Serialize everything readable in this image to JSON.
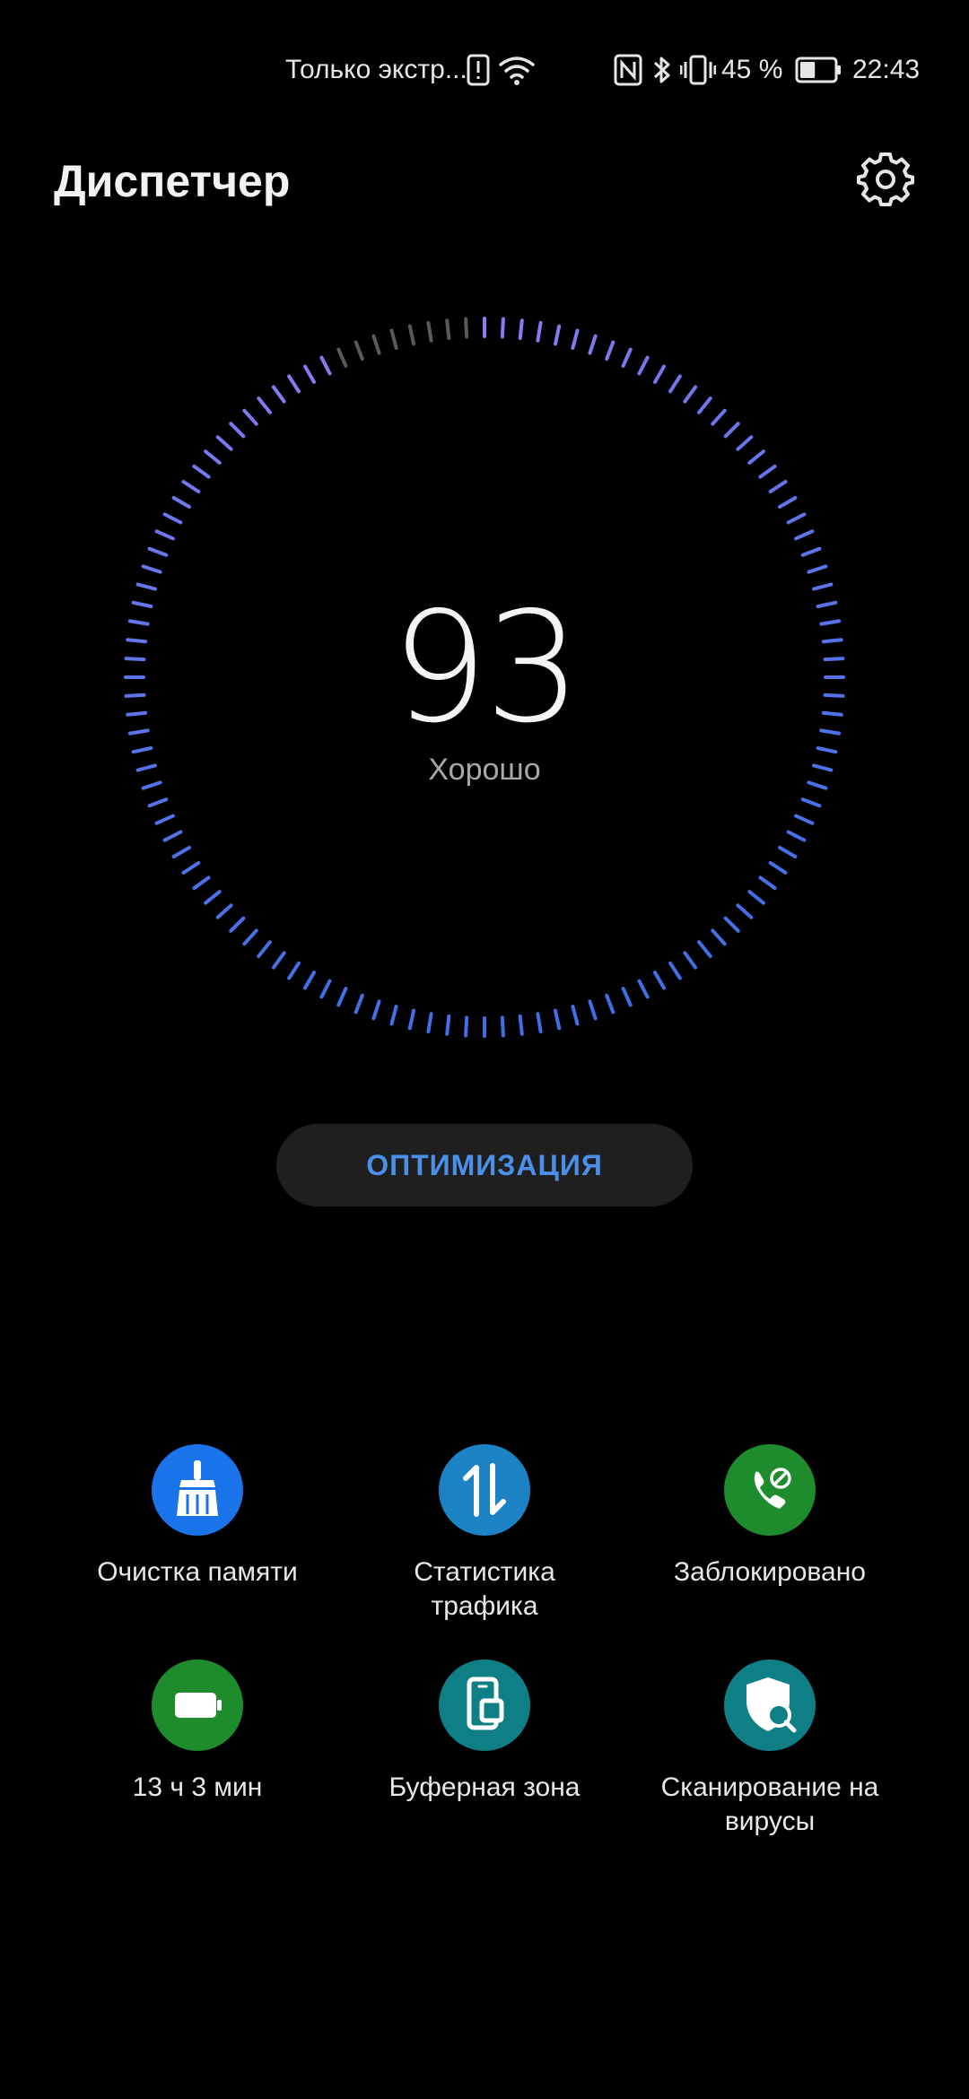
{
  "status_bar": {
    "notification_text": "Только экстр...",
    "battery_percent": "45 %",
    "battery_level": 0.45,
    "time": "22:43",
    "icons": [
      "alert-icon",
      "wifi-icon",
      "nfc-icon",
      "bluetooth-icon",
      "vibrate-icon",
      "battery-icon"
    ]
  },
  "header": {
    "title": "Диспетчер",
    "settings_icon": "gear-icon"
  },
  "gauge": {
    "score": "93",
    "status": "Хорошо",
    "fill_fraction": 0.93,
    "colors": {
      "start": "#8a7cf2",
      "end": "#3f6fe6",
      "inactive": "#5a5a5a"
    }
  },
  "optimize_button": {
    "label": "ОПТИМИЗАЦИЯ",
    "color": "#4a8fe8"
  },
  "tiles": [
    {
      "label": "Очистка памяти",
      "icon": "broom-icon",
      "color": "#1a73e8"
    },
    {
      "label": "Статистика трафика",
      "icon": "data-transfer-icon",
      "color": "#1b82c4"
    },
    {
      "label": "Заблокировано",
      "icon": "blocked-call-icon",
      "color": "#1e8c2d"
    },
    {
      "label": "13 ч 3 мин",
      "icon": "battery-icon",
      "color": "#1e8c2d"
    },
    {
      "label": "Буферная зона",
      "icon": "phone-clone-icon",
      "color": "#0f7f86"
    },
    {
      "label": "Сканирование на вирусы",
      "icon": "shield-search-icon",
      "color": "#0f7f86"
    }
  ]
}
